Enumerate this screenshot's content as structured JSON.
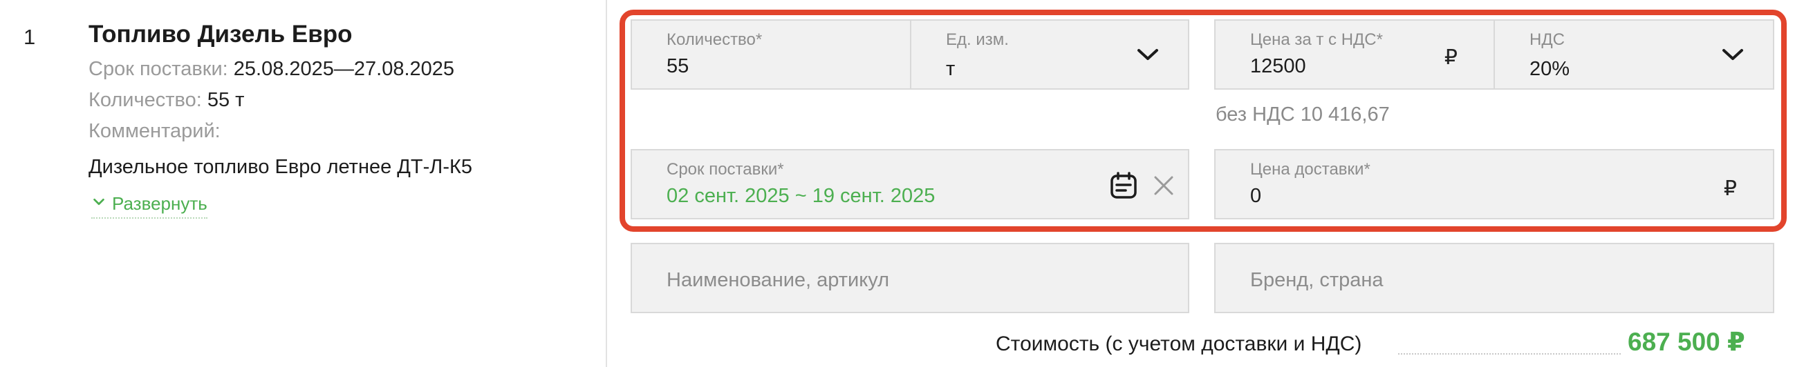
{
  "item": {
    "number": "1",
    "title": "Топливо Дизель Евро",
    "delivery_label": "Срок поставки:",
    "delivery_value": "25.08.2025—27.08.2025",
    "quantity_label": "Количество:",
    "quantity_value": "55 т",
    "comment_label": "Комментарий:",
    "comment_text": "Дизельное топливо Евро летнее ДТ-Л-К5",
    "expand_label": "Развернуть"
  },
  "form": {
    "quantity": {
      "label": "Количество*",
      "value": "55"
    },
    "unit": {
      "label": "Ед. изм.",
      "value": "т",
      "icon": "chevron-down-icon"
    },
    "price": {
      "label": "Цена за т с НДС*",
      "value": "12500",
      "currency": "₽"
    },
    "vat": {
      "label": "НДС",
      "value": "20%",
      "icon": "chevron-down-icon"
    },
    "price_without_vat": "без НДС 10 416,67",
    "delivery_period": {
      "label": "Срок поставки*",
      "value": "02 сент. 2025 ~ 19 сент. 2025"
    },
    "delivery_price": {
      "label": "Цена доставки*",
      "value": "0",
      "currency": "₽"
    },
    "name_placeholder": "Наименование, артикул",
    "brand_placeholder": "Бренд, страна"
  },
  "total": {
    "label": "Стоимость (с учетом доставки и НДС)",
    "value": "687 500 ₽"
  },
  "colors": {
    "accent_green": "#4caf50",
    "highlight_red": "#e2442c",
    "field_bg": "#f1f1f1",
    "field_border": "#d9d9d9"
  }
}
